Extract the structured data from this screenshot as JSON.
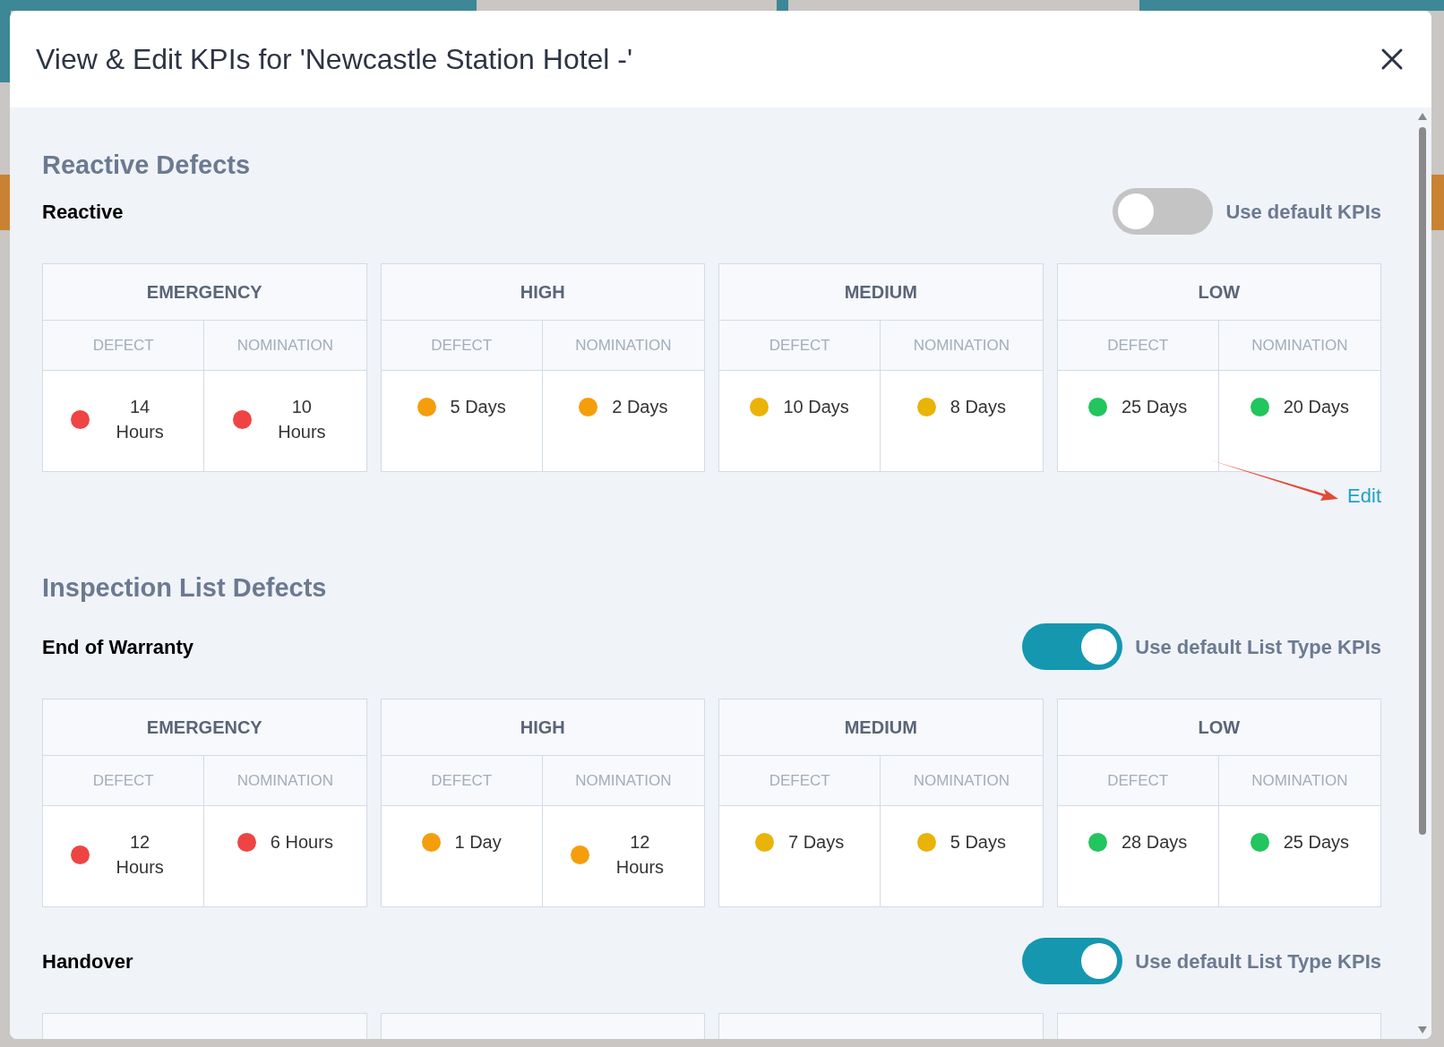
{
  "dialog": {
    "title": "View & Edit KPIs for 'Newcastle Station Hotel -'"
  },
  "sections": [
    {
      "title": "Reactive Defects",
      "groups": [
        {
          "name": "Reactive",
          "toggle": {
            "label": "Use default KPIs",
            "on": false
          },
          "link": "Edit",
          "levels": [
            {
              "label": "EMERGENCY",
              "cells": [
                {
                  "header": "DEFECT",
                  "value": "14 Hours",
                  "color": "#ef4444"
                },
                {
                  "header": "NOMINATION",
                  "value": "10 Hours",
                  "color": "#ef4444"
                }
              ]
            },
            {
              "label": "HIGH",
              "cells": [
                {
                  "header": "DEFECT",
                  "value": "5 Days",
                  "color": "#f59e0b"
                },
                {
                  "header": "NOMINATION",
                  "value": "2 Days",
                  "color": "#f59e0b"
                }
              ]
            },
            {
              "label": "MEDIUM",
              "cells": [
                {
                  "header": "DEFECT",
                  "value": "10 Days",
                  "color": "#eab308"
                },
                {
                  "header": "NOMINATION",
                  "value": "8 Days",
                  "color": "#eab308"
                }
              ]
            },
            {
              "label": "LOW",
              "cells": [
                {
                  "header": "DEFECT",
                  "value": "25 Days",
                  "color": "#22c55e"
                },
                {
                  "header": "NOMINATION",
                  "value": "20 Days",
                  "color": "#22c55e"
                }
              ]
            }
          ]
        }
      ]
    },
    {
      "title": "Inspection List Defects",
      "groups": [
        {
          "name": "End of Warranty",
          "toggle": {
            "label": "Use default List Type KPIs",
            "on": true
          },
          "levels": [
            {
              "label": "EMERGENCY",
              "cells": [
                {
                  "header": "DEFECT",
                  "value": "12 Hours",
                  "color": "#ef4444"
                },
                {
                  "header": "NOMINATION",
                  "value": "6 Hours",
                  "color": "#ef4444"
                }
              ]
            },
            {
              "label": "HIGH",
              "cells": [
                {
                  "header": "DEFECT",
                  "value": "1 Day",
                  "color": "#f59e0b"
                },
                {
                  "header": "NOMINATION",
                  "value": "12 Hours",
                  "color": "#f59e0b"
                }
              ]
            },
            {
              "label": "MEDIUM",
              "cells": [
                {
                  "header": "DEFECT",
                  "value": "7 Days",
                  "color": "#eab308"
                },
                {
                  "header": "NOMINATION",
                  "value": "5 Days",
                  "color": "#eab308"
                }
              ]
            },
            {
              "label": "LOW",
              "cells": [
                {
                  "header": "DEFECT",
                  "value": "28 Days",
                  "color": "#22c55e"
                },
                {
                  "header": "NOMINATION",
                  "value": "25 Days",
                  "color": "#22c55e"
                }
              ]
            }
          ]
        },
        {
          "name": "Handover",
          "toggle": {
            "label": "Use default List Type KPIs",
            "on": true
          }
        }
      ]
    }
  ]
}
